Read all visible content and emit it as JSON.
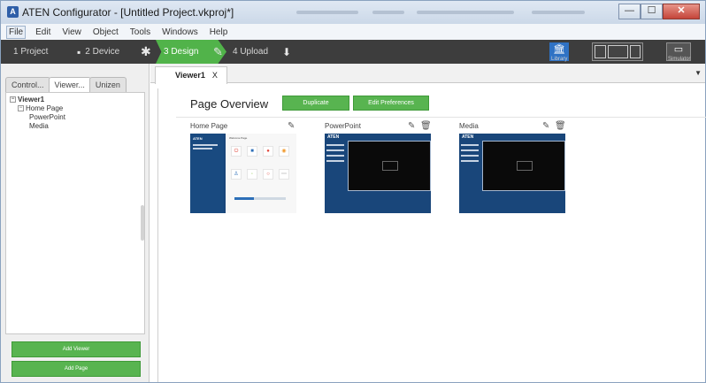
{
  "window": {
    "title": "ATEN Configurator - [Untitled Project.vkproj*]",
    "app_icon": "aten-app-icon",
    "buttons": {
      "minimize": "—",
      "maximize": "☐",
      "close": "✕"
    }
  },
  "menu": [
    "File",
    "Edit",
    "View",
    "Object",
    "Tools",
    "Windows",
    "Help"
  ],
  "workflow": {
    "steps": [
      "1 Project",
      "2 Device",
      "3 Design",
      "4 Upload"
    ],
    "active_step": "3 Design",
    "tools": {
      "library_label": "Library",
      "simulator_label": "Simulator"
    }
  },
  "left_panel": {
    "tabs": [
      "Control...",
      "Viewer...",
      "Unizen"
    ],
    "active_tab": "Viewer...",
    "tree": {
      "root": "Viewer1",
      "children": [
        {
          "label": "Home Page",
          "children": [
            "PowerPoint",
            "Media"
          ]
        }
      ]
    },
    "buttons": {
      "add_viewer": "Add Viewer",
      "add_page": "Add Page"
    }
  },
  "main": {
    "tab_label": "Viewer1",
    "tab_close": "X",
    "heading": "Page Overview",
    "duplicate_button": "Duplicate",
    "edit_preferences_button": "Edit Preferences",
    "pages": [
      {
        "name": "Home Page",
        "thumbnail": {
          "logo": "ATEN",
          "panel_title": "Welcome Page"
        }
      },
      {
        "name": "PowerPoint",
        "thumbnail": {
          "logo": "ATEN"
        }
      },
      {
        "name": "Media",
        "thumbnail": {
          "logo": "ATEN"
        }
      }
    ]
  },
  "colors": {
    "accent_green": "#58b450",
    "workflow_bar": "#3d3d3d",
    "thumbnail_blue": "#19467a"
  }
}
